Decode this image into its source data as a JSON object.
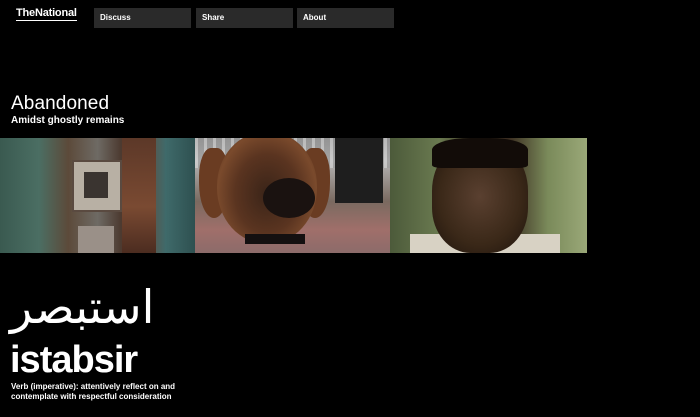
{
  "header": {
    "logo": "TheNational",
    "nav": [
      {
        "label": "Discuss"
      },
      {
        "label": "Share"
      },
      {
        "label": "About"
      }
    ]
  },
  "section": {
    "title": "Abandoned",
    "subtitle": "Amidst ghostly remains"
  },
  "gallery": {
    "panels": [
      {
        "subject": "decayed room with doorway"
      },
      {
        "subject": "dachshund close-up"
      },
      {
        "subject": "man portrait"
      }
    ]
  },
  "word": {
    "arabic": "استبصر",
    "latin": "istabsir",
    "definition": "Verb (imperative): attentively reflect on and contemplate with respectful consideration"
  },
  "colors": {
    "background": "#000000",
    "nav_button": "#2a2a2a",
    "text": "#ffffff"
  }
}
